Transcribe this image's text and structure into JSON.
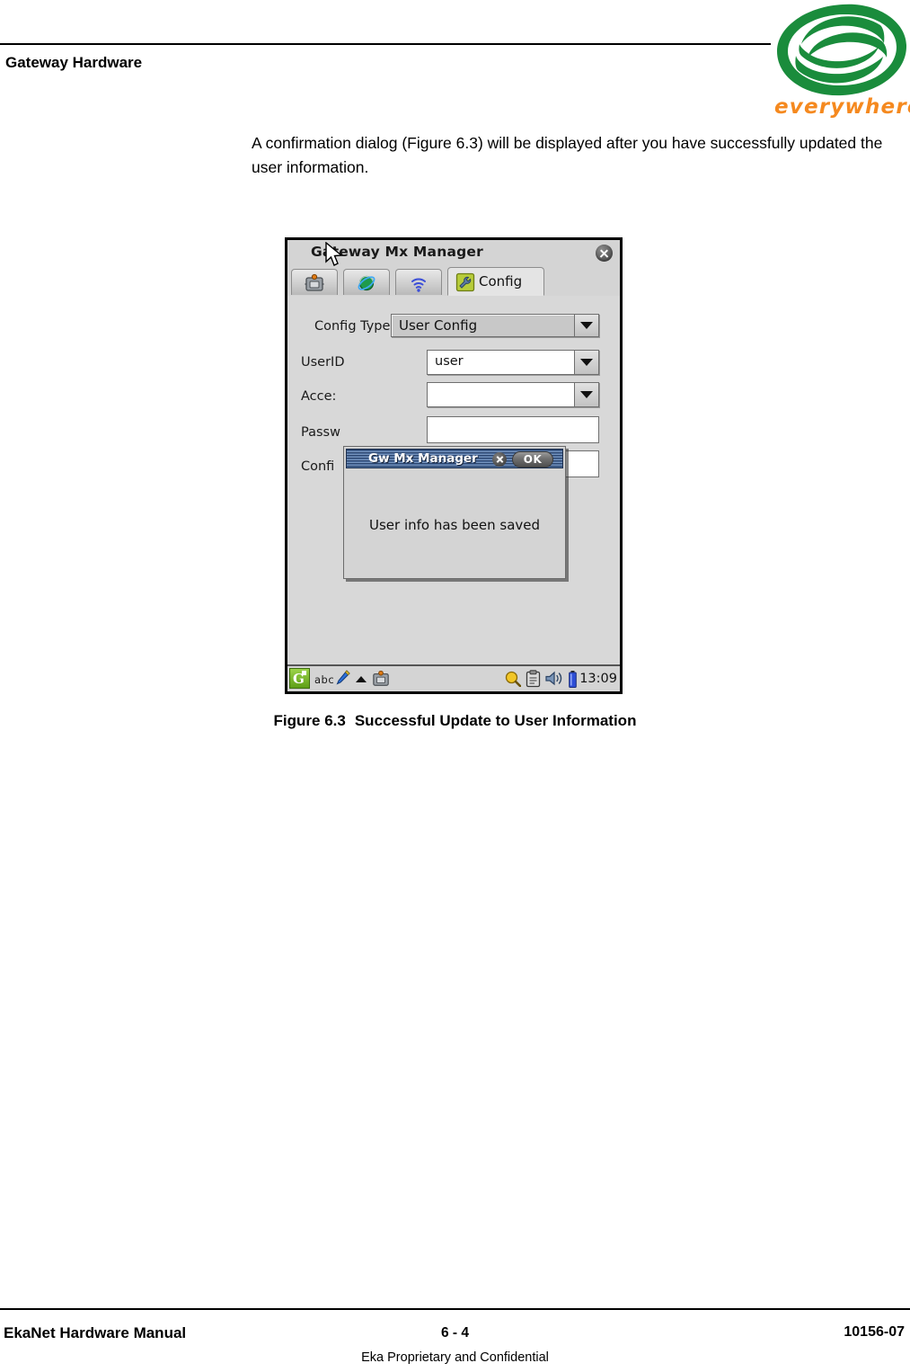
{
  "page": {
    "header_title": "Gateway Hardware",
    "body_paragraph": "A confirmation dialog (Figure 6.3) will be displayed after you have successfully updated the user information."
  },
  "logo": {
    "wordmark": "everywhere",
    "mark_color": "#1A8C3C",
    "word_color": "#F5891F"
  },
  "figure": {
    "caption_number": "Figure 6.3",
    "caption_text": "Successful Update to User Information"
  },
  "device": {
    "app": {
      "title": "Gateway Mx Manager",
      "close_icon": "close-circle-icon"
    },
    "tabs": [
      {
        "id": "tab-device",
        "label": "",
        "icon": "device-icon"
      },
      {
        "id": "tab-network",
        "label": "",
        "icon": "globe-network-icon"
      },
      {
        "id": "tab-wireless",
        "label": "",
        "icon": "wifi-signal-icon"
      },
      {
        "id": "tab-config",
        "label": "Config",
        "icon": "wrench-config-icon",
        "active": true
      }
    ],
    "form": {
      "config_type_label": "Config Type",
      "config_type_value": "User Config",
      "userid_label": "UserID",
      "userid_value": "user",
      "access_label": "Acce:",
      "access_value": "",
      "password_label": "Passw",
      "password_value": "",
      "confirm_label": "Confi",
      "confirm_value": ""
    },
    "dialog": {
      "title": "Gw Mx Manager",
      "close_label": "close-icon",
      "ok_label": "OK",
      "message": "User info has been saved"
    },
    "statusbar": {
      "start_icon": "start-menu-icon",
      "input_mode": "abc",
      "pencil_icon": "pencil-icon",
      "up_arrow_icon": "chevron-up-icon",
      "app_icon": "device-icon",
      "magnifier_icon": "magnifier-icon",
      "clipboard_icon": "clipboard-icon",
      "speaker_icon": "speaker-icon",
      "battery_icon": "battery-icon",
      "time": "13:09"
    }
  },
  "footer": {
    "left": "EkaNet Hardware Manual",
    "center": "6 - 4",
    "right": "10156-07",
    "note": "Eka Proprietary and Confidential"
  }
}
